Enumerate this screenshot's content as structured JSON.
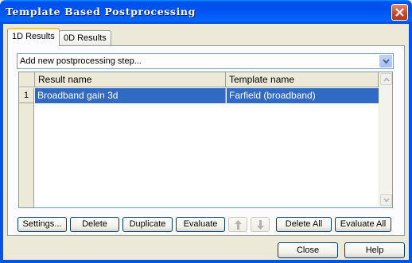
{
  "window": {
    "title": "Template Based Postprocessing"
  },
  "tabs": [
    {
      "label": "1D Results",
      "active": true
    },
    {
      "label": "0D Results",
      "active": false
    }
  ],
  "step_combo": {
    "value": "Add new postprocessing step..."
  },
  "grid": {
    "columns": [
      "Result name",
      "Template name"
    ],
    "rows": [
      {
        "index": "1",
        "result_name": "Broadband gain 3d",
        "template_name": "Farfield (broadband)",
        "selected": true
      }
    ]
  },
  "buttons": {
    "settings": "Settings...",
    "delete": "Delete",
    "duplicate": "Duplicate",
    "evaluate": "Evaluate",
    "delete_all": "Delete All",
    "evaluate_all": "Evaluate All",
    "close": "Close",
    "help": "Help"
  },
  "icons": {
    "move_up": "arrow-up-icon",
    "move_down": "arrow-down-icon",
    "close_window": "close-icon",
    "dropdown": "chevron-down-icon"
  },
  "colors": {
    "title_bar": "#0055e5",
    "selection": "#316ac5",
    "tab_highlight": "#ffc83c"
  }
}
